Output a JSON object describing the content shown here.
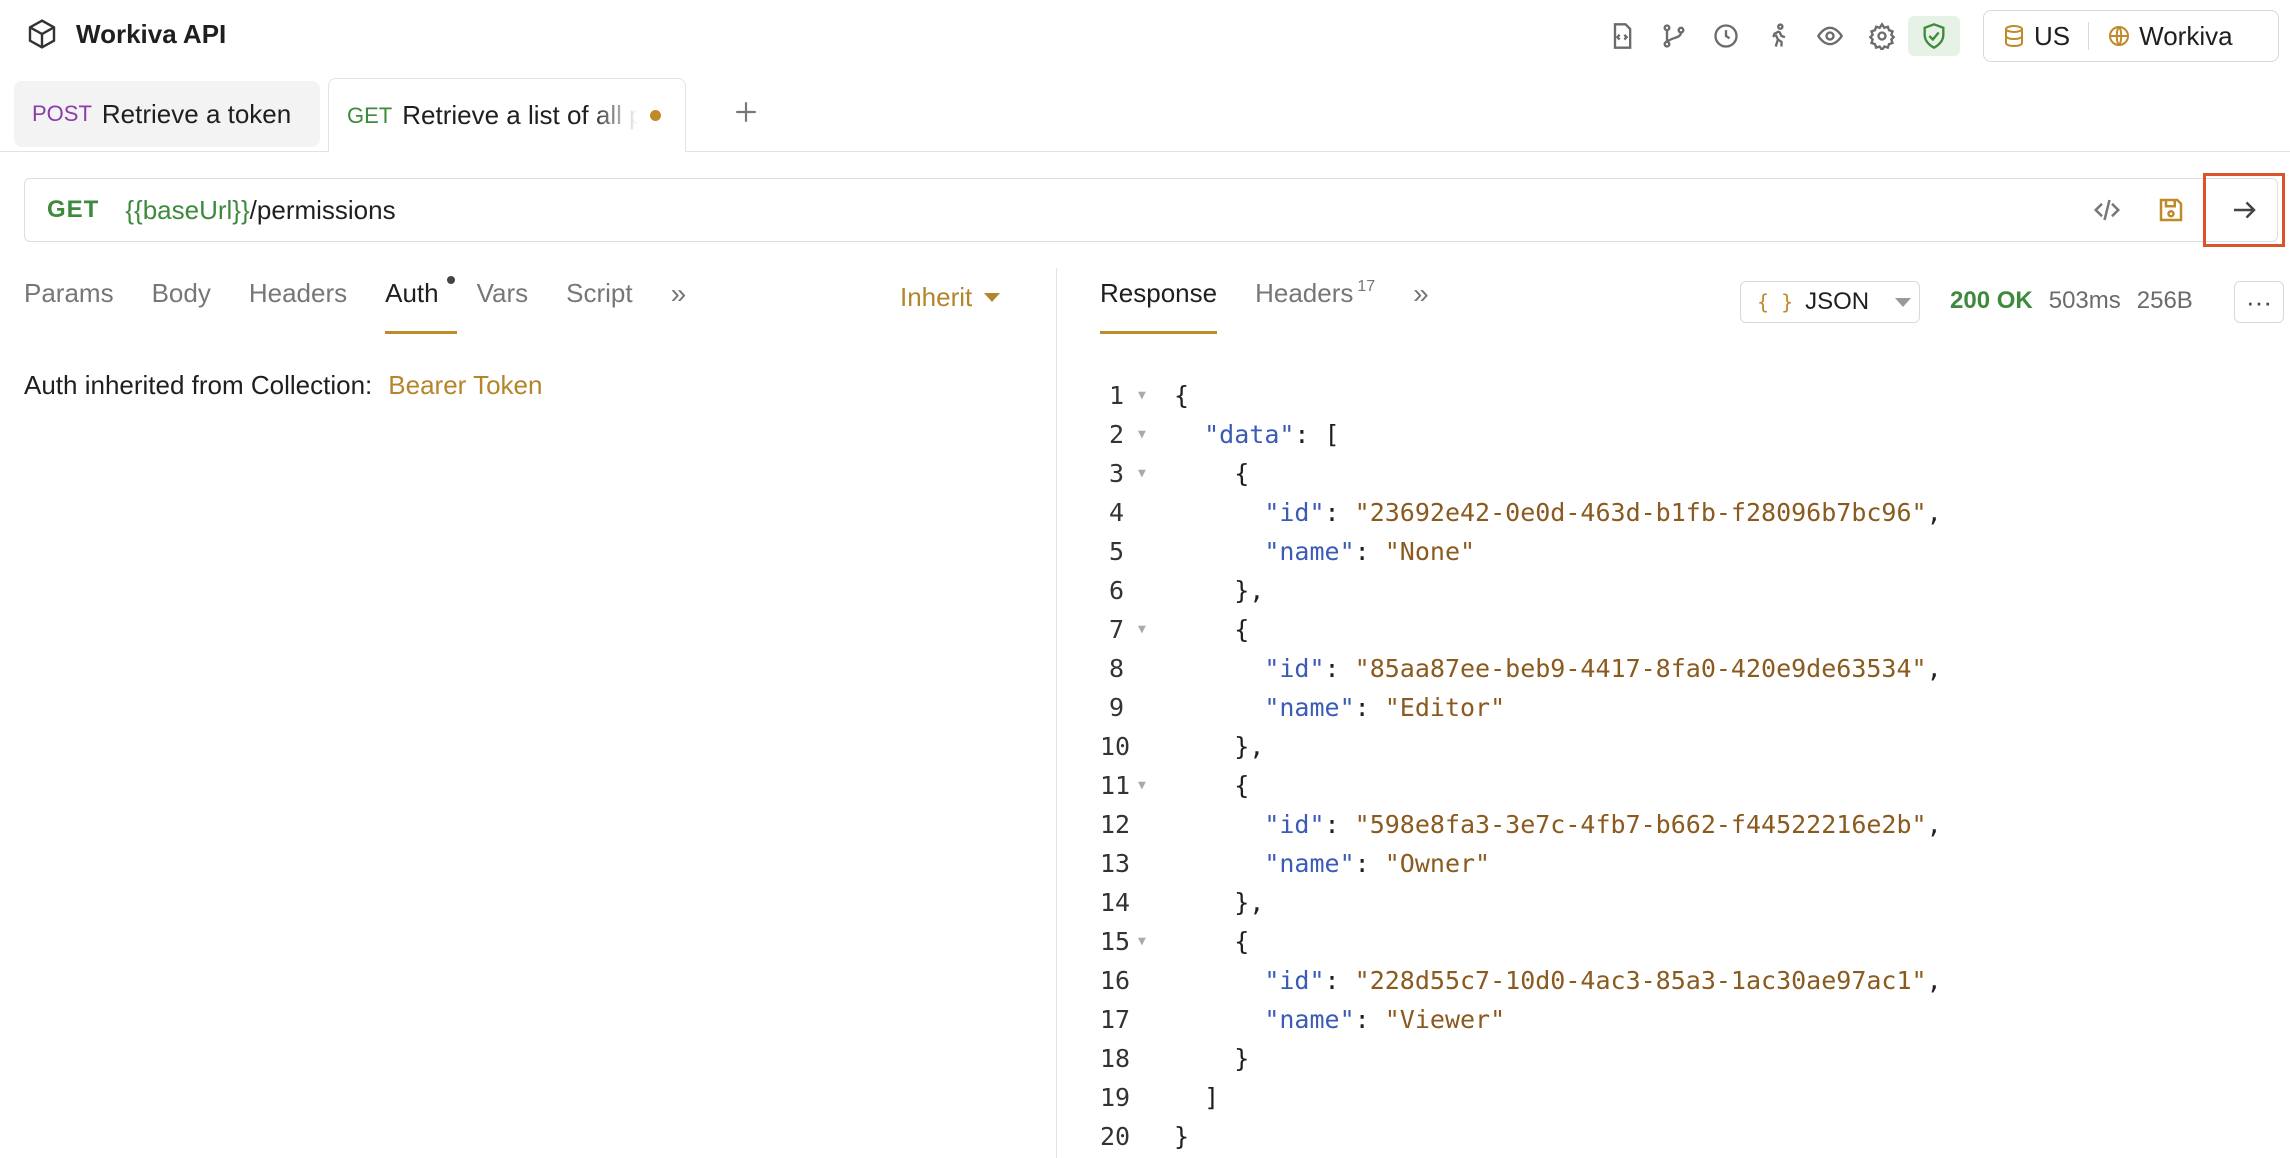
{
  "app": {
    "title": "Workiva API"
  },
  "header_icons": [
    "code-file-icon",
    "git-branch-icon",
    "history-icon",
    "runner-icon",
    "eye-icon",
    "settings-icon",
    "shield-check-icon"
  ],
  "env": {
    "region": "US",
    "workspace": "Workiva"
  },
  "tabs": [
    {
      "method": "POST",
      "label": "Retrieve a token"
    },
    {
      "method": "GET",
      "label": "Retrieve a list of all permissions"
    }
  ],
  "request": {
    "method": "GET",
    "url_var": "{{baseUrl}}",
    "url_path": "/permissions",
    "tabs": [
      "Params",
      "Body",
      "Headers",
      "Auth",
      "Vars",
      "Script"
    ],
    "more": "»",
    "auth_mode": "Inherit",
    "auth_info_label": "Auth inherited from Collection:",
    "auth_info_value": "Bearer Token"
  },
  "response": {
    "tabs": {
      "response": "Response",
      "headers": "Headers",
      "headers_count": "17",
      "more": "»"
    },
    "format": {
      "braces": "{ }",
      "label": "JSON"
    },
    "status": {
      "code": "200 OK",
      "time": "503ms",
      "size": "256B"
    },
    "more_menu": "···",
    "lines": [
      {
        "n": "1",
        "fold": true,
        "indent": "",
        "parts": [
          {
            "t": "p",
            "v": "{"
          }
        ]
      },
      {
        "n": "2",
        "fold": true,
        "indent": "  ",
        "parts": [
          {
            "t": "k",
            "v": "\"data\""
          },
          {
            "t": "p",
            "v": ": ["
          }
        ]
      },
      {
        "n": "3",
        "fold": true,
        "indent": "    ",
        "parts": [
          {
            "t": "p",
            "v": "{"
          }
        ]
      },
      {
        "n": "4",
        "fold": false,
        "indent": "      ",
        "parts": [
          {
            "t": "k",
            "v": "\"id\""
          },
          {
            "t": "p",
            "v": ": "
          },
          {
            "t": "s",
            "v": "\"23692e42-0e0d-463d-b1fb-f28096b7bc96\""
          },
          {
            "t": "p",
            "v": ","
          }
        ]
      },
      {
        "n": "5",
        "fold": false,
        "indent": "      ",
        "parts": [
          {
            "t": "k",
            "v": "\"name\""
          },
          {
            "t": "p",
            "v": ": "
          },
          {
            "t": "s",
            "v": "\"None\""
          }
        ]
      },
      {
        "n": "6",
        "fold": false,
        "indent": "    ",
        "parts": [
          {
            "t": "p",
            "v": "},"
          }
        ]
      },
      {
        "n": "7",
        "fold": true,
        "indent": "    ",
        "parts": [
          {
            "t": "p",
            "v": "{"
          }
        ]
      },
      {
        "n": "8",
        "fold": false,
        "indent": "      ",
        "parts": [
          {
            "t": "k",
            "v": "\"id\""
          },
          {
            "t": "p",
            "v": ": "
          },
          {
            "t": "s",
            "v": "\"85aa87ee-beb9-4417-8fa0-420e9de63534\""
          },
          {
            "t": "p",
            "v": ","
          }
        ]
      },
      {
        "n": "9",
        "fold": false,
        "indent": "      ",
        "parts": [
          {
            "t": "k",
            "v": "\"name\""
          },
          {
            "t": "p",
            "v": ": "
          },
          {
            "t": "s",
            "v": "\"Editor\""
          }
        ]
      },
      {
        "n": "10",
        "fold": false,
        "indent": "    ",
        "parts": [
          {
            "t": "p",
            "v": "},"
          }
        ]
      },
      {
        "n": "11",
        "fold": true,
        "indent": "    ",
        "parts": [
          {
            "t": "p",
            "v": "{"
          }
        ]
      },
      {
        "n": "12",
        "fold": false,
        "indent": "      ",
        "parts": [
          {
            "t": "k",
            "v": "\"id\""
          },
          {
            "t": "p",
            "v": ": "
          },
          {
            "t": "s",
            "v": "\"598e8fa3-3e7c-4fb7-b662-f44522216e2b\""
          },
          {
            "t": "p",
            "v": ","
          }
        ]
      },
      {
        "n": "13",
        "fold": false,
        "indent": "      ",
        "parts": [
          {
            "t": "k",
            "v": "\"name\""
          },
          {
            "t": "p",
            "v": ": "
          },
          {
            "t": "s",
            "v": "\"Owner\""
          }
        ]
      },
      {
        "n": "14",
        "fold": false,
        "indent": "    ",
        "parts": [
          {
            "t": "p",
            "v": "},"
          }
        ]
      },
      {
        "n": "15",
        "fold": true,
        "indent": "    ",
        "parts": [
          {
            "t": "p",
            "v": "{"
          }
        ]
      },
      {
        "n": "16",
        "fold": false,
        "indent": "      ",
        "parts": [
          {
            "t": "k",
            "v": "\"id\""
          },
          {
            "t": "p",
            "v": ": "
          },
          {
            "t": "s",
            "v": "\"228d55c7-10d0-4ac3-85a3-1ac30ae97ac1\""
          },
          {
            "t": "p",
            "v": ","
          }
        ]
      },
      {
        "n": "17",
        "fold": false,
        "indent": "      ",
        "parts": [
          {
            "t": "k",
            "v": "\"name\""
          },
          {
            "t": "p",
            "v": ": "
          },
          {
            "t": "s",
            "v": "\"Viewer\""
          }
        ]
      },
      {
        "n": "18",
        "fold": false,
        "indent": "    ",
        "parts": [
          {
            "t": "p",
            "v": "}"
          }
        ]
      },
      {
        "n": "19",
        "fold": false,
        "indent": "  ",
        "parts": [
          {
            "t": "p",
            "v": "]"
          }
        ]
      },
      {
        "n": "20",
        "fold": false,
        "indent": "",
        "parts": [
          {
            "t": "p",
            "v": "}"
          }
        ]
      }
    ]
  },
  "colors": {
    "accent": "#c08a2a",
    "get": "#3d8a3d",
    "post": "#8a3ea8",
    "highlight": "#d9532b",
    "json_key": "#3b5bb5",
    "json_string": "#8a5a1e"
  }
}
